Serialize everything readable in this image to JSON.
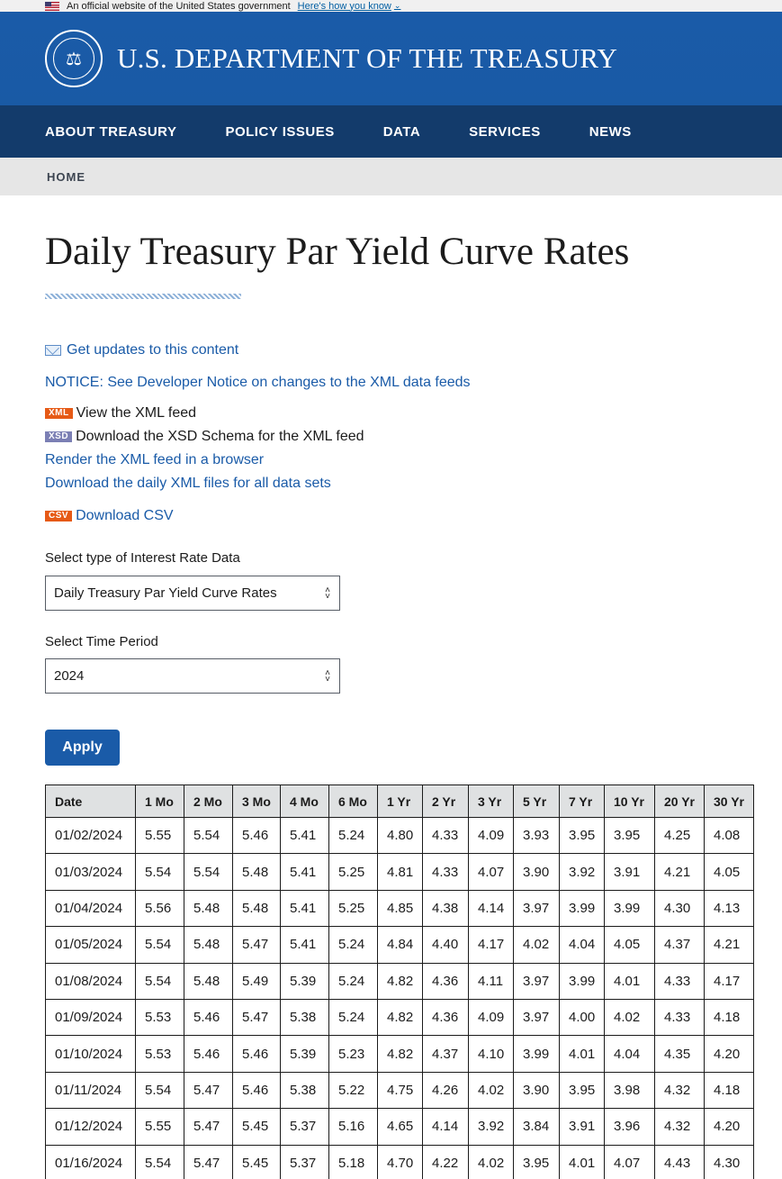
{
  "banner": {
    "text": "An official website of the United States government",
    "link": "Here's how you know"
  },
  "header": {
    "title": "U.S. DEPARTMENT OF THE TREASURY",
    "seal_icon": "treasury-seal-icon"
  },
  "nav": {
    "items": [
      "ABOUT TREASURY",
      "POLICY ISSUES",
      "DATA",
      "SERVICES",
      "NEWS"
    ]
  },
  "breadcrumb": {
    "home": "HOME"
  },
  "page": {
    "title": "Daily Treasury Par Yield Curve Rates",
    "updates_link": "Get updates to this content",
    "notice_link": "NOTICE: See Developer Notice on changes to the XML data feeds",
    "xml_badge": "XML",
    "xml_text": "View the XML feed",
    "xsd_badge": "XSD",
    "xsd_text": "Download the XSD Schema for the XML feed",
    "render_link": "Render the XML feed in a browser",
    "daily_link": "Download the daily XML files for all data sets",
    "csv_badge": "CSV",
    "csv_link": "Download CSV"
  },
  "form": {
    "type_label": "Select type of Interest Rate Data",
    "type_value": "Daily Treasury Par Yield Curve Rates",
    "period_label": "Select Time Period",
    "period_value": "2024",
    "apply_label": "Apply"
  },
  "table": {
    "headers": [
      "Date",
      "1 Mo",
      "2 Mo",
      "3 Mo",
      "4 Mo",
      "6 Mo",
      "1 Yr",
      "2 Yr",
      "3 Yr",
      "5 Yr",
      "7 Yr",
      "10 Yr",
      "20 Yr",
      "30 Yr"
    ],
    "rows": [
      [
        "01/02/2024",
        "5.55",
        "5.54",
        "5.46",
        "5.41",
        "5.24",
        "4.80",
        "4.33",
        "4.09",
        "3.93",
        "3.95",
        "3.95",
        "4.25",
        "4.08"
      ],
      [
        "01/03/2024",
        "5.54",
        "5.54",
        "5.48",
        "5.41",
        "5.25",
        "4.81",
        "4.33",
        "4.07",
        "3.90",
        "3.92",
        "3.91",
        "4.21",
        "4.05"
      ],
      [
        "01/04/2024",
        "5.56",
        "5.48",
        "5.48",
        "5.41",
        "5.25",
        "4.85",
        "4.38",
        "4.14",
        "3.97",
        "3.99",
        "3.99",
        "4.30",
        "4.13"
      ],
      [
        "01/05/2024",
        "5.54",
        "5.48",
        "5.47",
        "5.41",
        "5.24",
        "4.84",
        "4.40",
        "4.17",
        "4.02",
        "4.04",
        "4.05",
        "4.37",
        "4.21"
      ],
      [
        "01/08/2024",
        "5.54",
        "5.48",
        "5.49",
        "5.39",
        "5.24",
        "4.82",
        "4.36",
        "4.11",
        "3.97",
        "3.99",
        "4.01",
        "4.33",
        "4.17"
      ],
      [
        "01/09/2024",
        "5.53",
        "5.46",
        "5.47",
        "5.38",
        "5.24",
        "4.82",
        "4.36",
        "4.09",
        "3.97",
        "4.00",
        "4.02",
        "4.33",
        "4.18"
      ],
      [
        "01/10/2024",
        "5.53",
        "5.46",
        "5.46",
        "5.39",
        "5.23",
        "4.82",
        "4.37",
        "4.10",
        "3.99",
        "4.01",
        "4.04",
        "4.35",
        "4.20"
      ],
      [
        "01/11/2024",
        "5.54",
        "5.47",
        "5.46",
        "5.38",
        "5.22",
        "4.75",
        "4.26",
        "4.02",
        "3.90",
        "3.95",
        "3.98",
        "4.32",
        "4.18"
      ],
      [
        "01/12/2024",
        "5.55",
        "5.47",
        "5.45",
        "5.37",
        "5.16",
        "4.65",
        "4.14",
        "3.92",
        "3.84",
        "3.91",
        "3.96",
        "4.32",
        "4.20"
      ],
      [
        "01/16/2024",
        "5.54",
        "5.47",
        "5.45",
        "5.37",
        "5.18",
        "4.70",
        "4.22",
        "4.02",
        "3.95",
        "4.01",
        "4.07",
        "4.43",
        "4.30"
      ]
    ]
  }
}
